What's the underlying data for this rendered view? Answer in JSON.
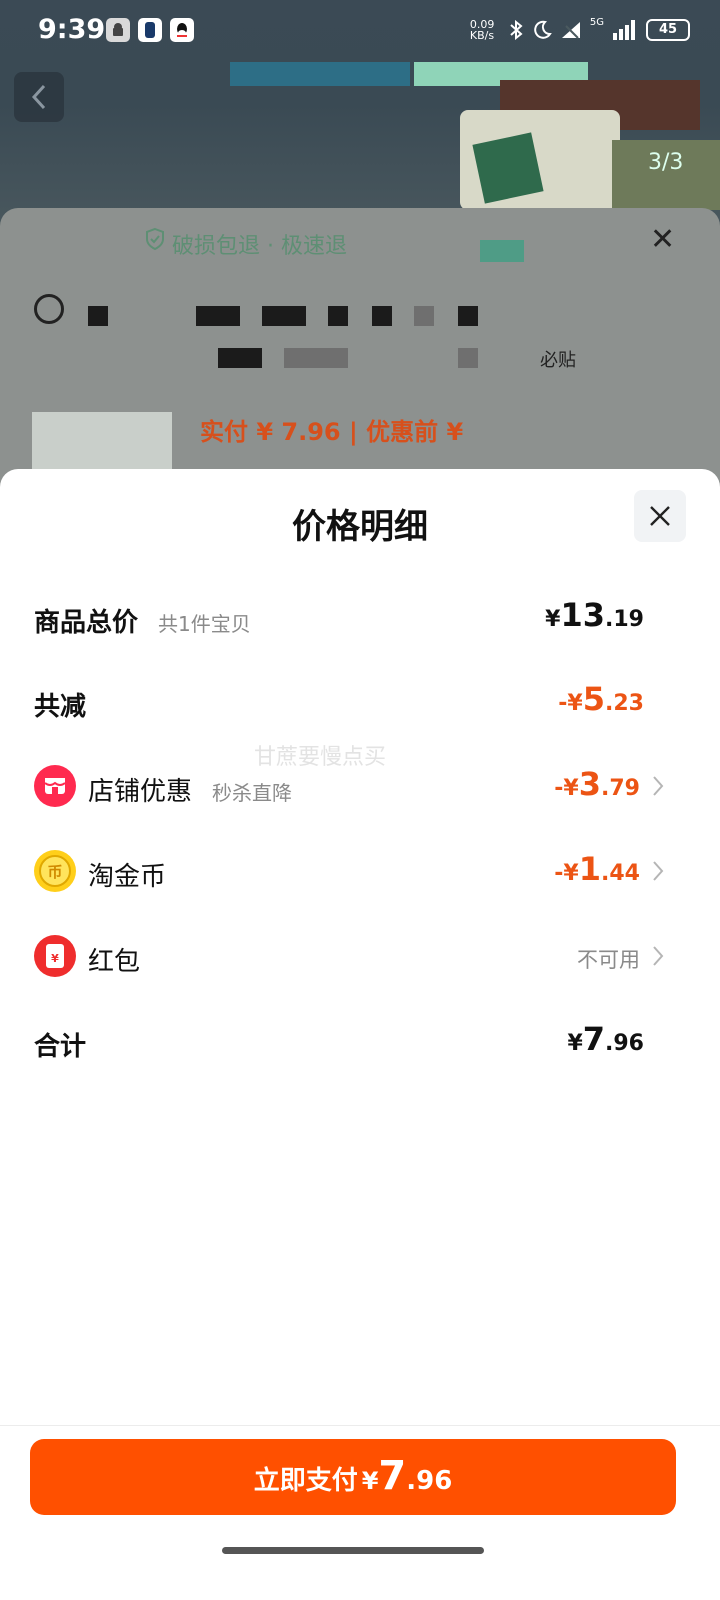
{
  "status_bar": {
    "time": "9:39",
    "net_speed": "0.09 KB/s",
    "signal_label": "5G",
    "battery": "45",
    "icons": [
      "android-icon",
      "app-icon",
      "qq-icon",
      "bluetooth-icon",
      "moon-icon",
      "wifi-icon",
      "signal-icon",
      "battery-icon"
    ]
  },
  "background": {
    "page_counter": "3/3",
    "guarantee_text": "破损包退 · 极速退",
    "price_text": "实付 ¥ 7.96 | 优惠前 ¥",
    "blurred_suffix": "必贴"
  },
  "sheet": {
    "title": "价格明细",
    "watermark": "甘蔗要慢点买",
    "rows": {
      "subtotal": {
        "label": "商品总价",
        "sub": "共1件宝贝",
        "sym": "¥",
        "int": "13",
        "dec": ".19"
      },
      "total_discount": {
        "label": "共减",
        "sym": "-¥",
        "int": "5",
        "dec": ".23"
      },
      "shop_discount": {
        "label": "店铺优惠",
        "sub": "秒杀直降",
        "sym": "-¥",
        "int": "3",
        "dec": ".79"
      },
      "gold_coin": {
        "label": "淘金币",
        "sym": "-¥",
        "int": "1",
        "dec": ".44"
      },
      "red_packet": {
        "label": "红包",
        "status": "不可用",
        "icon_glyph": "¥"
      },
      "total": {
        "label": "合计",
        "sym": "¥",
        "int": "7",
        "dec": ".96"
      }
    },
    "pay_button": {
      "label": "立即支付",
      "sym": "¥",
      "int": "7",
      "dec": ".96"
    }
  },
  "colors": {
    "accent_orange": "#ff5000",
    "discount_text": "#ec5414",
    "guarantee_green": "#5e8f74"
  }
}
